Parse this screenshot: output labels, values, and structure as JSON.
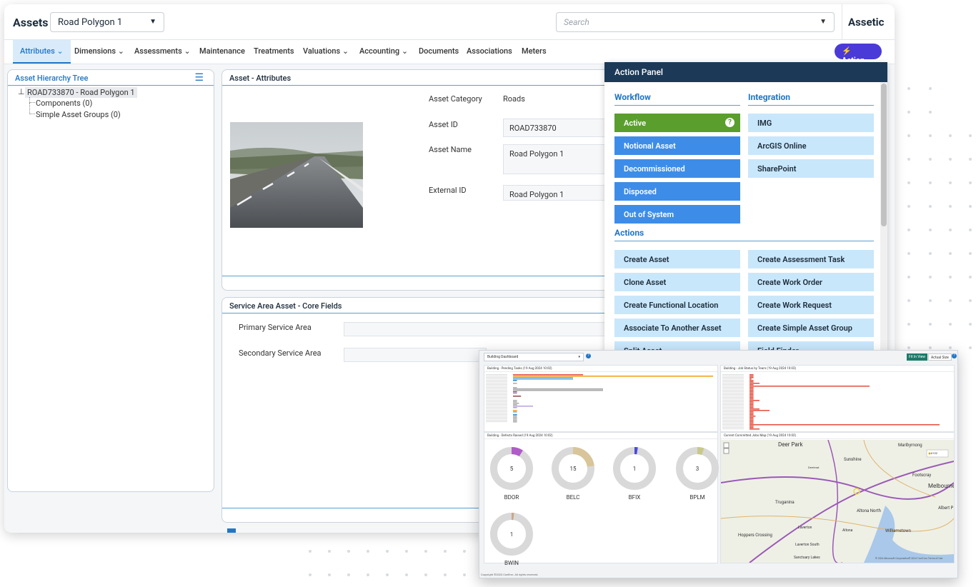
{
  "header": {
    "app_title": "Assets",
    "asset_selector": "Road Polygon 1",
    "search_placeholder": "Search",
    "brand": "Assetic"
  },
  "menu": {
    "items": [
      "Attributes",
      "Dimensions",
      "Assessments",
      "Maintenance",
      "Treatments",
      "Valuations",
      "Accounting",
      "Documents",
      "Associations",
      "Meters"
    ],
    "active": "Attributes",
    "action_button": "Action"
  },
  "tree": {
    "title": "Asset Hierarchy Tree",
    "root": "ROAD733870 - Road Polygon 1",
    "children": [
      "Components (0)",
      "Simple Asset Groups (0)"
    ]
  },
  "attributes": {
    "title": "Asset - Attributes",
    "category_label": "Asset Category",
    "category_value": "Roads",
    "id_label": "Asset ID",
    "id_value": "ROAD733870",
    "name_label": "Asset Name",
    "name_value": "Road Polygon 1",
    "external_label": "External ID",
    "external_value": "Road Polygon 1"
  },
  "service_area": {
    "title": "Service Area Asset - Core Fields",
    "primary_label": "Primary Service Area",
    "secondary_label": "Secondary Service Area"
  },
  "action_panel": {
    "title": "Action Panel",
    "workflow_title": "Workflow",
    "integration_title": "Integration",
    "actions_title": "Actions",
    "workflow": [
      "Active",
      "Notional Asset",
      "Decommissioned",
      "Disposed",
      "Out of System"
    ],
    "integration": [
      "IMG",
      "ArcGIS Online",
      "SharePoint"
    ],
    "actions_left": [
      "Create Asset",
      "Clone Asset",
      "Create Functional Location",
      "Associate To Another Asset",
      "Split Asset"
    ],
    "actions_right": [
      "Create Assessment Task",
      "Create Work Order",
      "Create Work Request",
      "Create Simple Asset Group",
      "Field Finder"
    ]
  },
  "dashboard": {
    "selector": "Building Dashboard",
    "fit_btn": "Fit In View",
    "actual_btn": "Actual Size",
    "panel1_title": "Building - Pending Tasks (19 Aug 2024 10:02)",
    "panel2_title": "Building - Job Status by Team (19 Aug 2024 10:02)",
    "panel3_title": "Building - Defects Raised (19 Aug 2024 10:02)",
    "panel4_title": "Current Committed Jobs Map (19 Aug 2024 10:02)",
    "donuts": [
      {
        "label": "BDOR",
        "value": "5",
        "color": "#b05cc8"
      },
      {
        "label": "BELC",
        "value": "15",
        "color": "#d8c59a"
      },
      {
        "label": "BFIX",
        "value": "1",
        "color": "#4a4ad8"
      },
      {
        "label": "BPLM",
        "value": "3",
        "color": "#c8c88a"
      },
      {
        "label": "BWIN",
        "value": "1",
        "color": "#c8a888"
      }
    ],
    "map_places": [
      "Deer Park",
      "Maribyrnong",
      "Sunshine",
      "Derrimut",
      "Footscray",
      "Melbourne",
      "Truganina",
      "Altona North",
      "Albert P",
      "Laverton",
      "Altona",
      "Williamstown",
      "Hoppers Crossing",
      "Laverton South",
      "Sanctuary Lakes"
    ],
    "map_legend": "6102",
    "map_credit": "© 2024 Microsoft Corporation© 2024 TomTom Terms of Use",
    "footer": "Copyright ©2023 Confirm. All rights reserved."
  }
}
